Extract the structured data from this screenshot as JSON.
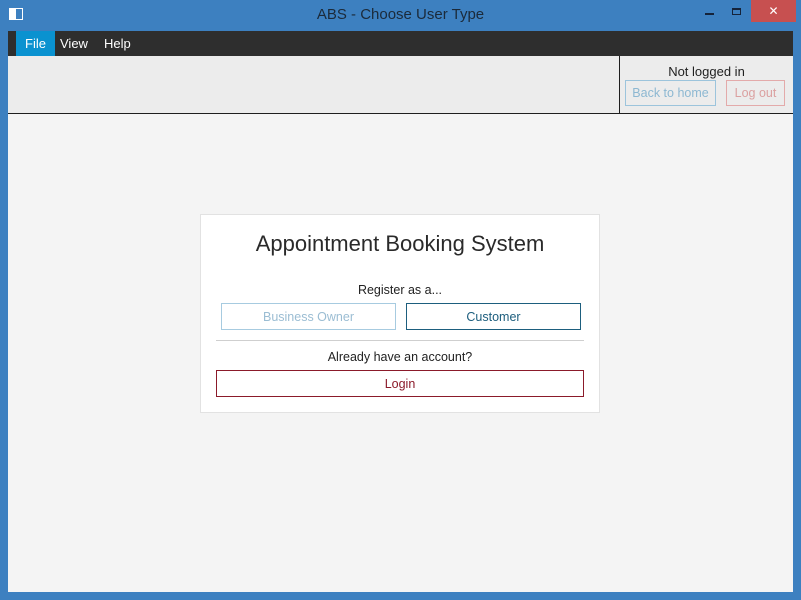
{
  "window": {
    "title": "ABS - Choose User Type",
    "close_glyph": "✕"
  },
  "menu": {
    "items": [
      "File",
      "View",
      "Help"
    ]
  },
  "toolbar": {
    "status": "Not logged in",
    "back_label": "Back to home",
    "logout_label": "Log out"
  },
  "card": {
    "title": "Appointment Booking System",
    "register_prompt": "Register as a...",
    "business_owner_label": "Business Owner",
    "customer_label": "Customer",
    "account_prompt": "Already have an account?",
    "login_label": "Login"
  },
  "colors": {
    "window_frame": "#3d80c0",
    "menubar": "#2e2e2e",
    "menu_active": "#0a92d0",
    "close_button": "#c75050",
    "customer_accent": "#1d5e7e",
    "login_accent": "#8b1a2a"
  },
  "icons": {
    "app": "window-app-icon",
    "minimize": "minimize-icon",
    "maximize": "maximize-icon",
    "close": "close-icon"
  }
}
